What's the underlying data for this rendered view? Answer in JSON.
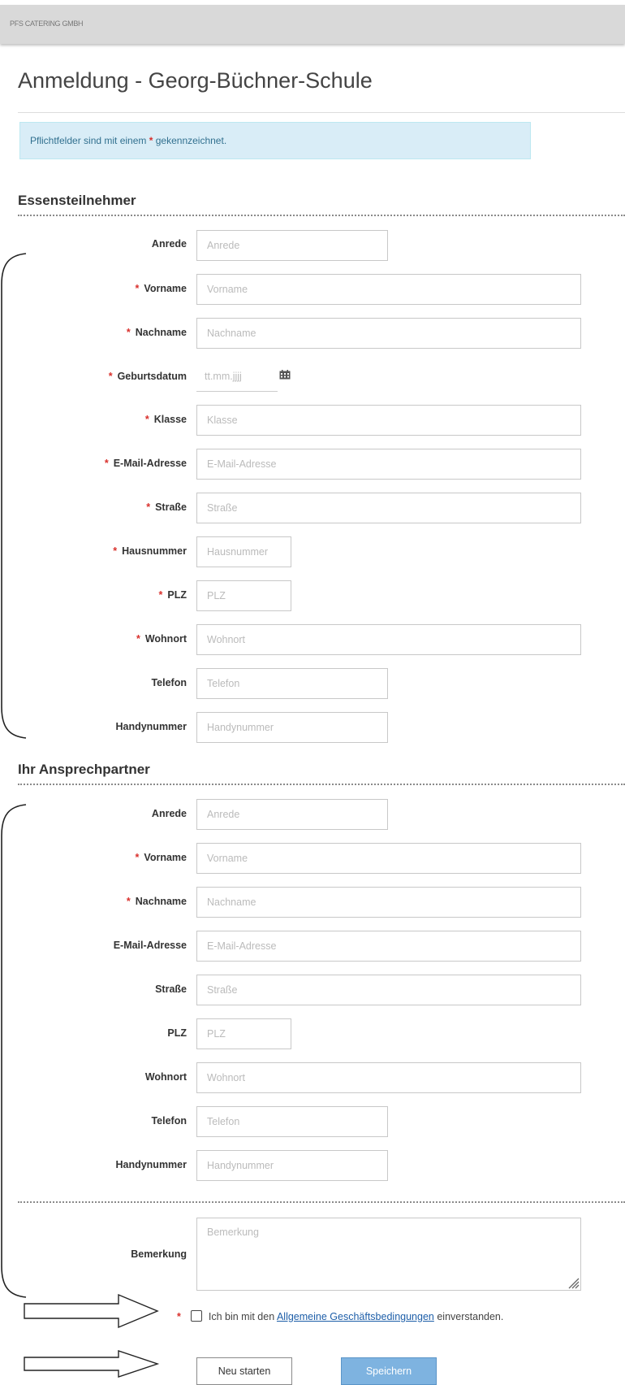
{
  "header": {
    "logo_text": "PFS CATERING GMBH"
  },
  "page": {
    "title": "Anmeldung - Georg-Büchner-Schule"
  },
  "notice": {
    "before": "Pflichtfelder sind mit einem",
    "star": "*",
    "after": "gekennzeichnet."
  },
  "section1": {
    "title": "Essensteilnehmer",
    "fields": [
      {
        "label": "Anrede",
        "required": false,
        "placeholder": "Anrede"
      },
      {
        "label": "Vorname",
        "required": true,
        "placeholder": "Vorname"
      },
      {
        "label": "Nachname",
        "required": true,
        "placeholder": "Nachname"
      },
      {
        "label": "Geburtsdatum",
        "required": true,
        "placeholder": "tt.mm.jjjj"
      },
      {
        "label": "Klasse",
        "required": true,
        "placeholder": "Klasse"
      },
      {
        "label": "E-Mail-Adresse",
        "required": true,
        "placeholder": "E-Mail-Adresse"
      },
      {
        "label": "Straße",
        "required": true,
        "placeholder": "Straße"
      },
      {
        "label": "Hausnummer",
        "required": true,
        "placeholder": "Hausnummer"
      },
      {
        "label": "PLZ",
        "required": true,
        "placeholder": "PLZ"
      },
      {
        "label": "Wohnort",
        "required": true,
        "placeholder": "Wohnort"
      },
      {
        "label": "Telefon",
        "required": false,
        "placeholder": "Telefon"
      },
      {
        "label": "Handynummer",
        "required": false,
        "placeholder": "Handynummer"
      }
    ]
  },
  "section2": {
    "title": "Ihr Ansprechpartner",
    "fields": [
      {
        "label": "Anrede",
        "required": false,
        "placeholder": "Anrede"
      },
      {
        "label": "Vorname",
        "required": true,
        "placeholder": "Vorname"
      },
      {
        "label": "Nachname",
        "required": true,
        "placeholder": "Nachname"
      },
      {
        "label": "E-Mail-Adresse",
        "required": false,
        "placeholder": "E-Mail-Adresse"
      },
      {
        "label": "Straße",
        "required": false,
        "placeholder": "Straße"
      },
      {
        "label": "PLZ",
        "required": false,
        "placeholder": "PLZ"
      },
      {
        "label": "Wohnort",
        "required": false,
        "placeholder": "Wohnort"
      },
      {
        "label": "Telefon",
        "required": false,
        "placeholder": "Telefon"
      },
      {
        "label": "Handynummer",
        "required": false,
        "placeholder": "Handynummer"
      }
    ]
  },
  "remarks": {
    "label": "Bemerkung",
    "placeholder": "Bemerkung"
  },
  "agb": {
    "star": "*",
    "before": "Ich bin mit den",
    "link": "Allgemeine Geschäftsbedingungen",
    "after": "einverstanden.",
    "checked": false
  },
  "buttons": {
    "reset": "Neu starten",
    "save": "Speichern"
  },
  "colors": {
    "required_star": "#d9302c",
    "info_bg": "#d9edf7",
    "info_text": "#31708f",
    "save_button": "#7eb3e0",
    "link": "#1d5ea8"
  },
  "icons": {
    "date": "calendar-icon",
    "textarea_resize": "resize-grip-icon"
  }
}
